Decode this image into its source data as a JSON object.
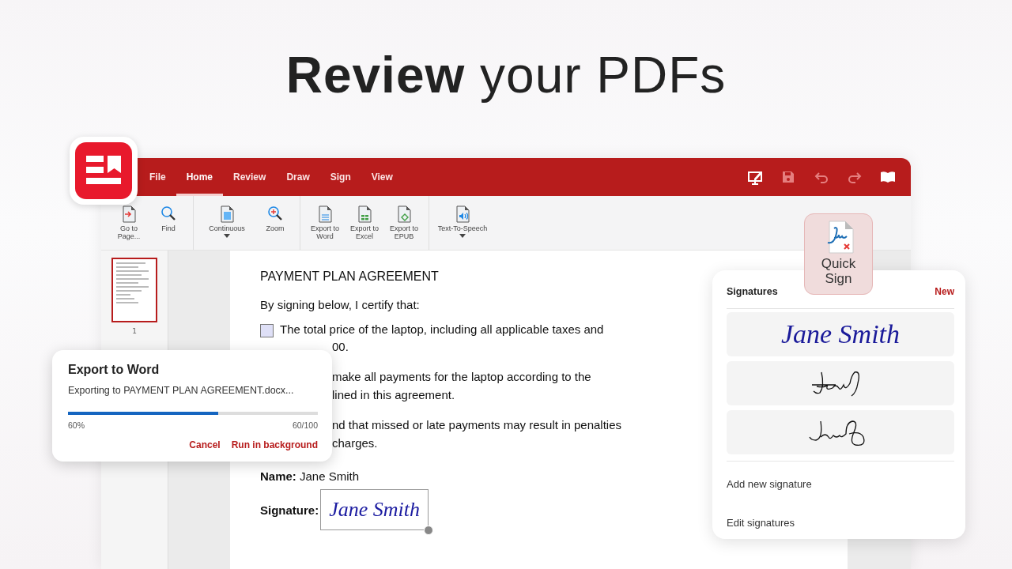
{
  "headline": "**Review** your PDFs",
  "menu_tabs": [
    {
      "label": "File",
      "selected": false
    },
    {
      "label": "Home",
      "selected": true
    },
    {
      "label": "Review",
      "selected": false
    },
    {
      "label": "Draw",
      "selected": false
    },
    {
      "label": "Sign",
      "selected": false
    },
    {
      "label": "View",
      "selected": false
    }
  ],
  "header_actions": [
    {
      "kind": "annotate",
      "disabled": false
    },
    {
      "kind": "save",
      "disabled": true
    },
    {
      "kind": "undo",
      "disabled": true
    },
    {
      "kind": "redo",
      "disabled": true
    },
    {
      "kind": "read",
      "disabled": false
    }
  ],
  "toolbar_groups": [
    [
      {
        "kind": "goto",
        "label": "Go to Page...",
        "dropdown": false
      },
      {
        "kind": "find",
        "label": "Find",
        "dropdown": false
      }
    ],
    [
      {
        "kind": "continuous",
        "label": "Continuous",
        "dropdown": true
      },
      {
        "kind": "zoom",
        "label": "Zoom",
        "dropdown": false
      }
    ],
    [
      {
        "kind": "word",
        "label": "Export to Word",
        "dropdown": false
      },
      {
        "kind": "excel",
        "label": "Export to Excel",
        "dropdown": false
      },
      {
        "kind": "epub",
        "label": "Export to EPUB",
        "dropdown": false
      }
    ],
    [
      {
        "kind": "tts",
        "label": "Text-To-Speech",
        "dropdown": true
      }
    ]
  ],
  "thumbnails": [
    {
      "page": "1",
      "selected": true
    }
  ],
  "document": {
    "title": "PAYMENT PLAN AGREEMENT",
    "intro": "By signing below, I certify that:",
    "items": [
      {
        "checked": false,
        "lines": [
          "The total price of the laptop, including all applicable taxes and"
        ]
      }
    ],
    "paragraphs": [
      [
        "00."
      ],
      [
        "make all payments for the laptop according to the",
        "lined in this agreement."
      ],
      [
        "nd that missed or late payments may result in penalties",
        "charges."
      ]
    ],
    "name_label": "Name:",
    "name_value": "Jane Smith",
    "signature_label": "Signature:",
    "signature_value": "Jane Smith"
  },
  "export_dialog": {
    "title": "Export to Word",
    "message": "Exporting to PAYMENT PLAN AGREEMENT.docx...",
    "level": 0.6,
    "percent": "60%",
    "count": "60/100",
    "buttons": [
      "Cancel",
      "Run in background"
    ]
  },
  "quick_sign": {
    "label": "Quick Sign"
  },
  "signatures_panel": {
    "title": "Signatures",
    "new": "New",
    "signatures": [
      {
        "kind": "typed",
        "text": "Jane Smith"
      },
      {
        "kind": "drawn"
      },
      {
        "kind": "drawn2"
      }
    ],
    "actions": [
      "Add new signature",
      "Edit signatures"
    ]
  }
}
